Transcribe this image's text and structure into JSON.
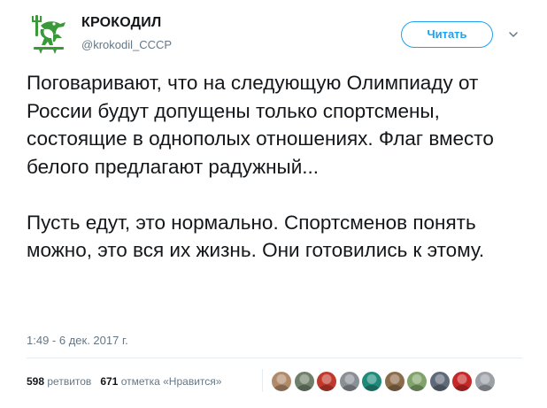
{
  "header": {
    "display_name": "КРОКОДИЛ",
    "handle": "@krokodil_CCCP",
    "follow_label": "Читать"
  },
  "tweet": {
    "paragraphs": [
      "Поговаривают, что на следующую Олимпиаду от России будут допущены только спортсмены, состоящие в однополых отношениях. Флаг вместо белого предлагают радужный...",
      "Пусть едут, это нормально. Спортсменов понять можно, это вся их жизнь. Они готовились к этому."
    ],
    "timestamp": "1:49 - 6 дек. 2017 г."
  },
  "stats": {
    "retweets_count": "598",
    "retweets_label": "ретвитов",
    "likes_count": "671",
    "likes_label": "отметка «Нравится»"
  },
  "likers": [
    {
      "name": "liker-avatar-1",
      "color": "#b08a6a"
    },
    {
      "name": "liker-avatar-2",
      "color": "#6f7f6a"
    },
    {
      "name": "liker-avatar-3",
      "color": "#c0392b"
    },
    {
      "name": "liker-avatar-4",
      "color": "#8a8f96"
    },
    {
      "name": "liker-avatar-5",
      "color": "#1f8a7a"
    },
    {
      "name": "liker-avatar-6",
      "color": "#8b6b4a"
    },
    {
      "name": "liker-avatar-7",
      "color": "#7fa36a"
    },
    {
      "name": "liker-avatar-8",
      "color": "#5f6a78"
    },
    {
      "name": "liker-avatar-9",
      "color": "#c62828"
    },
    {
      "name": "liker-avatar-10",
      "color": "#9aa0a6"
    }
  ],
  "colors": {
    "brand_green": "#3a9a3a",
    "accent_blue": "#1da1f2",
    "secondary_text": "#657786"
  }
}
